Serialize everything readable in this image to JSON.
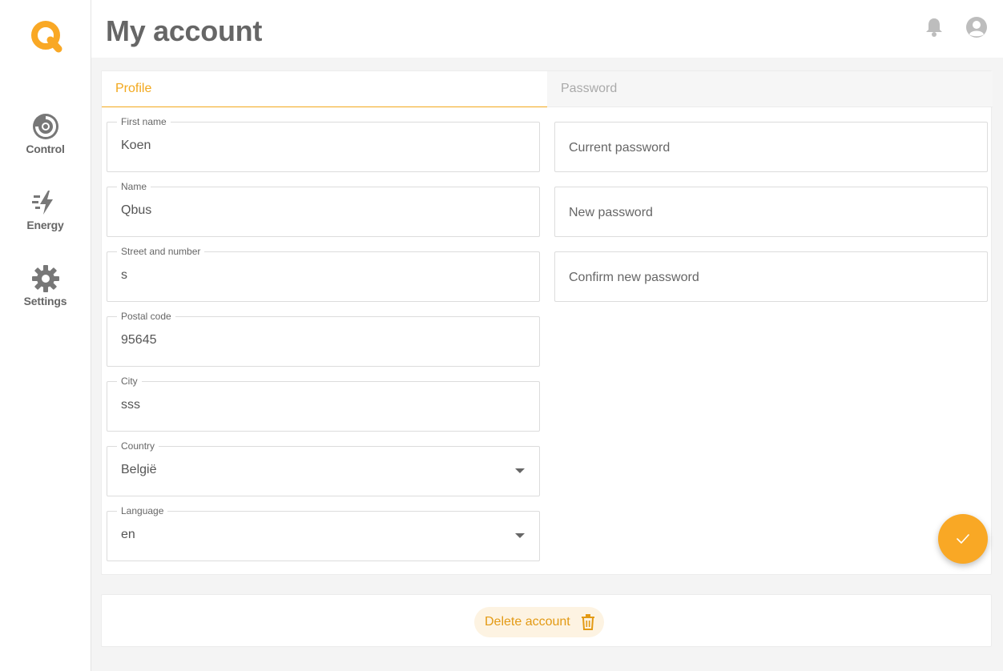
{
  "app": {
    "accent": "#f9a825"
  },
  "sidebar": {
    "logo": "qbus-logo",
    "items": [
      {
        "label": "Control",
        "icon": "control-icon"
      },
      {
        "label": "Energy",
        "icon": "energy-bolt-icon"
      },
      {
        "label": "Settings",
        "icon": "gear-icon"
      }
    ]
  },
  "header": {
    "title": "My account",
    "icons": [
      "bell-icon",
      "user-avatar-icon"
    ]
  },
  "tabs": [
    {
      "label": "Profile",
      "active": true
    },
    {
      "label": "Password",
      "active": false
    }
  ],
  "profile": {
    "first_name": {
      "label": "First name",
      "value": "Koen"
    },
    "name": {
      "label": "Name",
      "value": "Qbus"
    },
    "street": {
      "label": "Street and number",
      "value": "s"
    },
    "postal": {
      "label": "Postal code",
      "value": "95645"
    },
    "city": {
      "label": "City",
      "value": "sss"
    },
    "country": {
      "label": "Country",
      "value": "België"
    },
    "language": {
      "label": "Language",
      "value": "en"
    }
  },
  "password": {
    "current_placeholder": "Current password",
    "new_placeholder": "New password",
    "confirm_placeholder": "Confirm new password"
  },
  "actions": {
    "save_icon": "check-icon",
    "delete_label": "Delete account",
    "delete_icon": "trash-icon"
  }
}
